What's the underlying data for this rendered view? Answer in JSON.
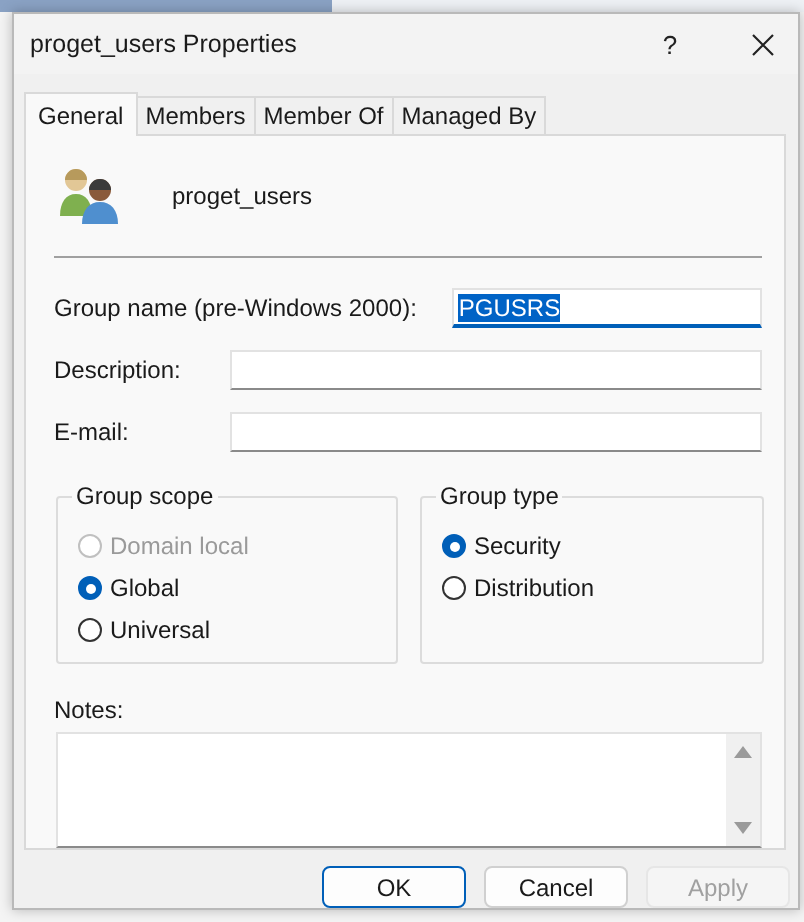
{
  "window": {
    "title": "proget_users Properties",
    "help": "?"
  },
  "tabs": [
    {
      "label": "General",
      "selected": true
    },
    {
      "label": "Members",
      "selected": false
    },
    {
      "label": "Member Of",
      "selected": false
    },
    {
      "label": "Managed By",
      "selected": false
    }
  ],
  "object_name": "proget_users",
  "fields": [
    {
      "label": "Group name (pre-Windows 2000):",
      "value": "PGUSRS",
      "focused": true
    },
    {
      "label": "Description:",
      "focused": false
    },
    {
      "label": "E-mail:",
      "focused": false
    }
  ],
  "group_scope": {
    "title": "Group scope",
    "options": [
      {
        "label": "Domain local",
        "selected": false,
        "disabled": true
      },
      {
        "label": "Global",
        "selected": true,
        "disabled": false
      },
      {
        "label": "Universal",
        "selected": false,
        "disabled": false
      }
    ]
  },
  "group_type": {
    "title": "Group type",
    "options": [
      {
        "label": "Security",
        "selected": true,
        "disabled": false
      },
      {
        "label": "Distribution",
        "selected": false,
        "disabled": false
      }
    ]
  },
  "notes": {
    "label": "Notes:"
  },
  "buttons": [
    {
      "label": "OK",
      "default": true,
      "disabled": false
    },
    {
      "label": "Cancel",
      "default": false,
      "disabled": false
    },
    {
      "label": "Apply",
      "default": false,
      "disabled": true
    }
  ]
}
